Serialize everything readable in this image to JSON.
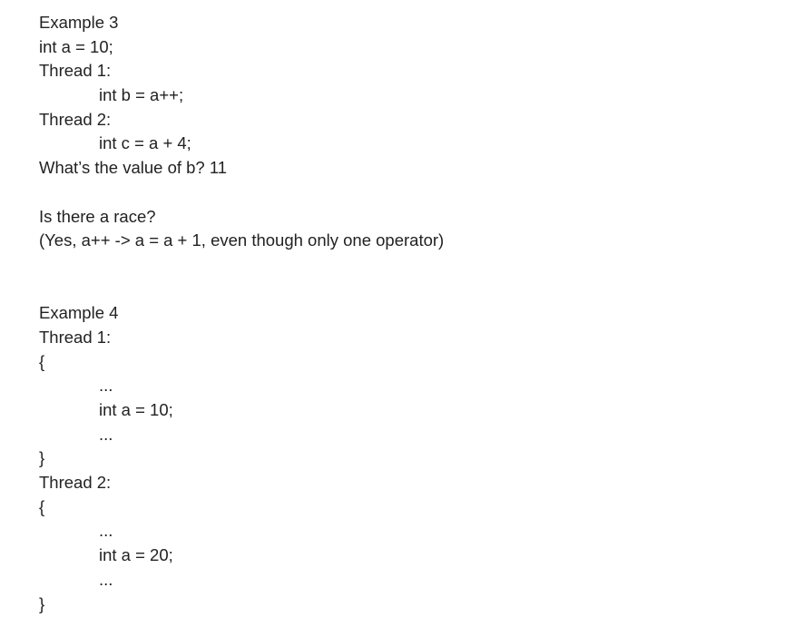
{
  "example3": {
    "title": "Example 3",
    "decl": "int a = 10;",
    "thread1_label": "Thread 1:",
    "thread1_code": "int b = a++;",
    "thread2_label": "Thread 2:",
    "thread2_code": "int c = a + 4;",
    "question": "What’s the value of b? 11",
    "race_question": "Is there a race?",
    "race_answer": "(Yes, a++ -> a = a + 1, even though only one operator)"
  },
  "example4": {
    "title": "Example 4",
    "thread1_label": "Thread 1:",
    "thread1_open": "{",
    "thread1_ellipsis_top": "...",
    "thread1_code": "int a = 10;",
    "thread1_ellipsis_bottom": "...",
    "thread1_close": "}",
    "thread2_label": "Thread 2:",
    "thread2_open": "{",
    "thread2_ellipsis_top": "...",
    "thread2_code": "int a = 20;",
    "thread2_ellipsis_bottom": "...",
    "thread2_close": "}"
  }
}
